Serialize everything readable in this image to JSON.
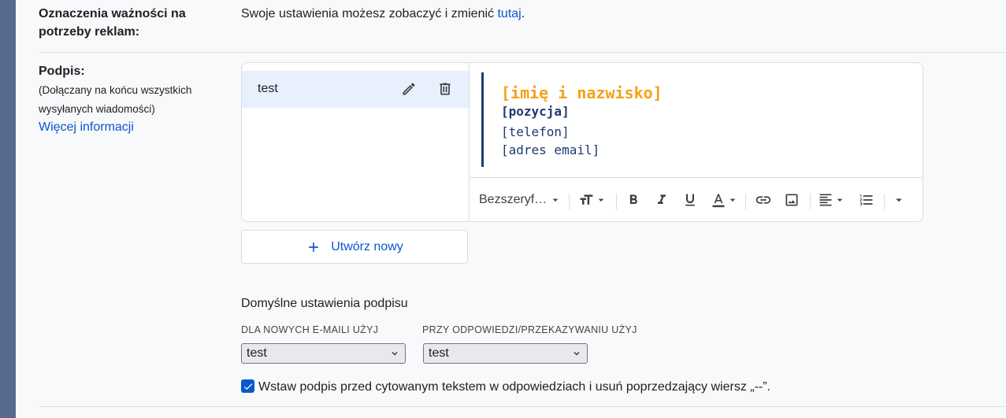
{
  "importance": {
    "label_line1": "Oznaczenia ważności na",
    "label_line2": "potrzeby reklam:",
    "text": "Swoje ustawienia możesz zobaczyć i zmienić ",
    "link": "tutaj",
    "text_end": "."
  },
  "signature": {
    "label": "Podpis:",
    "desc_line1": "(Dołączany na końcu wszystkich",
    "desc_line2": "wysyłanych wiadomości)",
    "more_info": "Więcej informacji",
    "items": [
      {
        "name": "test"
      }
    ],
    "preview": {
      "name": "[imię i nazwisko]",
      "position": "[pozycja]",
      "phone": "[telefon]",
      "email": "[adres email]",
      "name_color": "#f4a11a",
      "text_color": "#1f3a6e"
    },
    "toolbar": {
      "font": "Bezszeryf…",
      "icons": [
        "text-size-icon",
        "bold-icon",
        "italic-icon",
        "underline-icon",
        "text-color-icon",
        "link-icon",
        "image-icon",
        "align-icon",
        "numbered-list-icon",
        "more-options-icon"
      ]
    },
    "create_new": "Utwórz nowy"
  },
  "defaults": {
    "heading": "Domyślne ustawienia podpisu",
    "new_label": "DLA NOWYCH E-MAILI UŻYJ",
    "new_value": "test",
    "reply_label": "PRZY ODPOWIEDZI/PRZEKAZYWANIU UŻYJ",
    "reply_value": "test",
    "checkbox_checked": true,
    "checkbox_label": "Wstaw podpis przed cytowanym tekstem w odpowiedziach i usuń poprzedzający wiersz „--”."
  },
  "colors": {
    "accent": "#0b57d0",
    "sidebar": "#556b8d",
    "selected": "#e8f0fe"
  }
}
